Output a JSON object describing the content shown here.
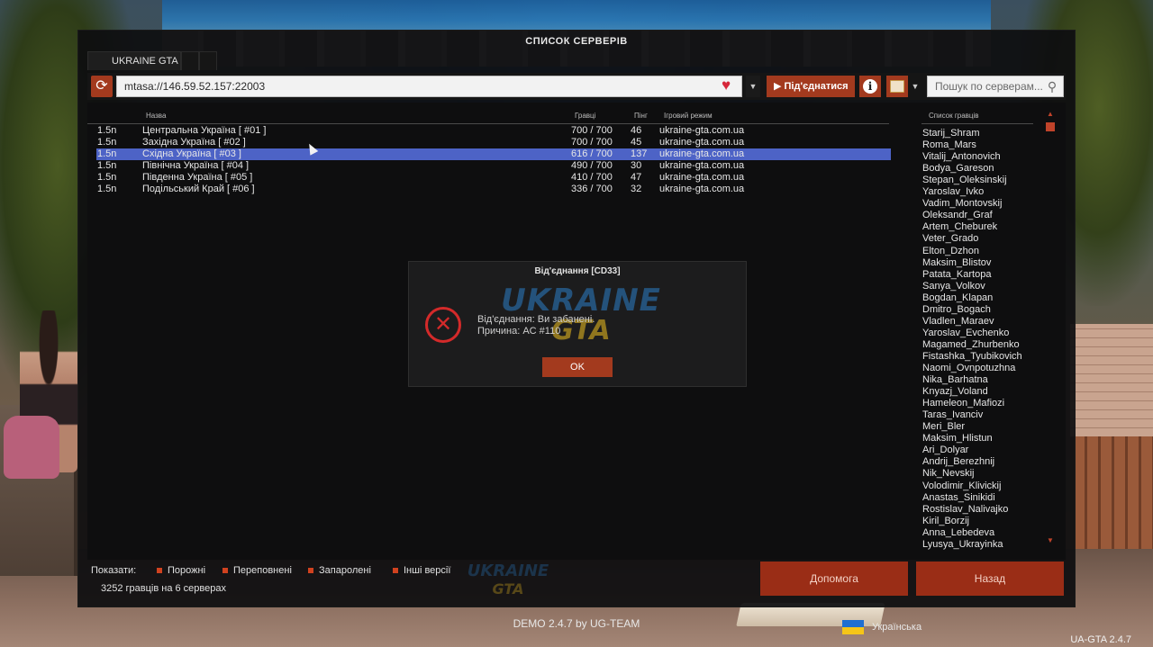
{
  "window": {
    "title": "СПИСОК СЕРВЕРІВ"
  },
  "tabs": [
    {
      "label": "UKRAINE GTA"
    }
  ],
  "toolbar": {
    "address": "mtasa://146.59.52.157:22003",
    "connect_label": "Під'єднатися",
    "search_placeholder": "Пошук по серверам..."
  },
  "icons": {
    "refresh": "refresh-icon",
    "favorite": "heart-icon",
    "play": "play-icon",
    "info": "info-icon",
    "open": "open-folder-icon",
    "search": "search-icon",
    "error": "error-icon"
  },
  "columns": {
    "name": "Назва",
    "players": "Гравці",
    "ping": "Пінг",
    "gamemode": "Ігровий режим",
    "players_list": "Список гравців"
  },
  "servers": [
    {
      "version": "1.5n",
      "name": "Центральна Україна [ #01 ]",
      "players": "700 / 700",
      "ping": "46",
      "gamemode": "ukraine-gta.com.ua",
      "selected": false
    },
    {
      "version": "1.5n",
      "name": "Західна Україна [ #02 ]",
      "players": "700 / 700",
      "ping": "45",
      "gamemode": "ukraine-gta.com.ua",
      "selected": false
    },
    {
      "version": "1.5n",
      "name": "Східна Україна [ #03 ]",
      "players": "616 / 700",
      "ping": "137",
      "gamemode": "ukraine-gta.com.ua",
      "selected": true
    },
    {
      "version": "1.5n",
      "name": "Північна Україна [ #04 ]",
      "players": "490 / 700",
      "ping": "30",
      "gamemode": "ukraine-gta.com.ua",
      "selected": false
    },
    {
      "version": "1.5n",
      "name": "Південна Україна [ #05 ]",
      "players": "410 / 700",
      "ping": "47",
      "gamemode": "ukraine-gta.com.ua",
      "selected": false
    },
    {
      "version": "1.5n",
      "name": "Подільський Край [ #06 ]",
      "players": "336 / 700",
      "ping": "32",
      "gamemode": "ukraine-gta.com.ua",
      "selected": false
    }
  ],
  "players": [
    "Starij_Shram",
    "Roma_Mars",
    "Vitalij_Antonovich",
    "Bodya_Gareson",
    "Stepan_Oleksinskij",
    "Yaroslav_Ivko",
    "Vadim_Montovskij",
    "Oleksandr_Graf",
    "Artem_Cheburek",
    "Veter_Grado",
    "Elton_Dzhon",
    "Maksim_Blistov",
    "Patata_Kartopa",
    "Sanya_Volkov",
    "Bogdan_Klapan",
    "Dmitro_Bogach",
    "Vladlen_Maraev",
    "Yaroslav_Evchenko",
    "Magamed_Zhurbenko",
    "Fistashka_Tyubikovich",
    "Naomi_Ovnpotuzhna",
    "Nika_Barhatna",
    "Knyazj_Voland",
    "Hameleon_Mafiozi",
    "Taras_Ivanciv",
    "Meri_Bler",
    "Maksim_Hlistun",
    "Ari_Dolyar",
    "Andrij_Berezhnij",
    "Nik_Nevskij",
    "Volodimir_Klivickij",
    "Anastas_Sinikidi",
    "Rostislav_Nalivajko",
    "Kiril_Borzij",
    "Anna_Lebedeva",
    "Lyusya_Ukrayinka"
  ],
  "dialog": {
    "title": "Від'єднання [CD33]",
    "line1": "Від'єднання: Ви забанені.",
    "line2": "Причина: AC #110",
    "ok_label": "OK",
    "logo_line1": "UKRAINE",
    "logo_line2": "GTA"
  },
  "filters": {
    "label": "Показати:",
    "items": [
      "Порожні",
      "Переповнені",
      "Запаролені",
      "Інші версії"
    ]
  },
  "status": {
    "count": "3252 гравців на 6 серверах"
  },
  "buttons": {
    "help": "Допомога",
    "back": "Назад"
  },
  "footer": {
    "version": "DEMO 2.4.7 by UG-TEAM",
    "language": "Українська",
    "build": "UA-GTA 2.4.7",
    "logo_line1": "UKRAINE",
    "logo_line2": "GTA"
  },
  "colors": {
    "accent": "#a33a1e",
    "selection": "#4d63c6",
    "error": "#d42a2a",
    "logo_blue": "#2b7fc9",
    "logo_yellow": "#f0c020"
  }
}
